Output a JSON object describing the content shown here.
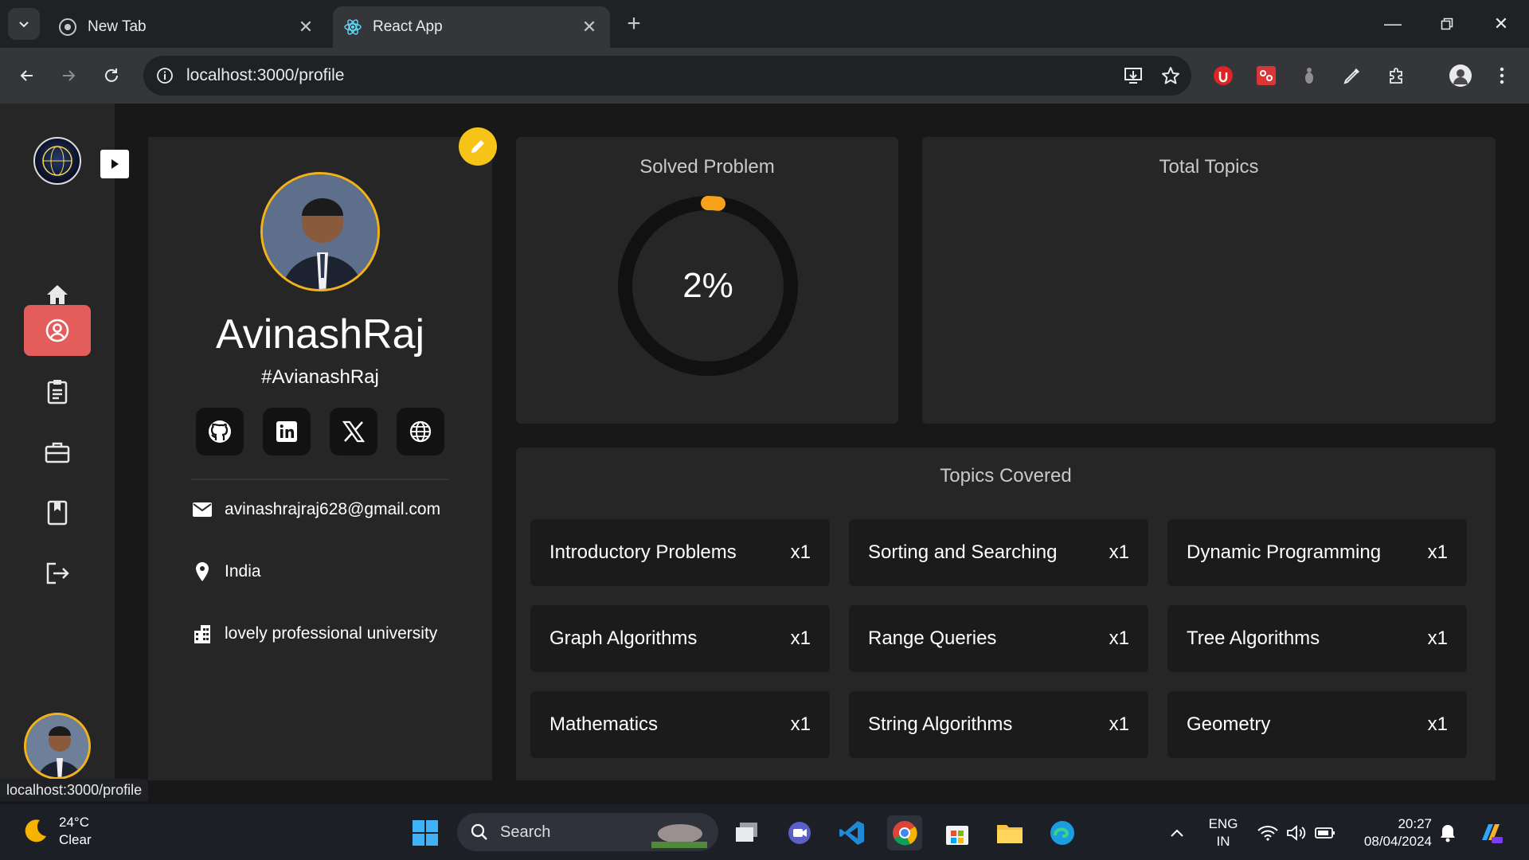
{
  "browser": {
    "tabs": [
      {
        "label": "New Tab",
        "active": false
      },
      {
        "label": "React App",
        "active": true
      }
    ],
    "url": "localhost:3000/profile",
    "status_url": "localhost:3000/profile"
  },
  "profile": {
    "name": "AvinashRaj",
    "handle": "#AvianashRaj",
    "email": "avinashrajraj628@gmail.com",
    "location": "India",
    "organization": "lovely professional university",
    "socials": [
      "github-icon",
      "linkedin-icon",
      "x-icon",
      "globe-icon"
    ]
  },
  "solved": {
    "title": "Solved Problem",
    "percent_label": "2%",
    "percent": 2
  },
  "total_topics": {
    "title": "Total Topics"
  },
  "topics_covered": {
    "title": "Topics Covered",
    "items": [
      {
        "name": "Introductory Problems",
        "count": "x1"
      },
      {
        "name": "Sorting and Searching",
        "count": "x1"
      },
      {
        "name": "Dynamic Programming",
        "count": "x1"
      },
      {
        "name": "Graph Algorithms",
        "count": "x1"
      },
      {
        "name": "Range Queries",
        "count": "x1"
      },
      {
        "name": "Tree Algorithms",
        "count": "x1"
      },
      {
        "name": "Mathematics",
        "count": "x1"
      },
      {
        "name": "String Algorithms",
        "count": "x1"
      },
      {
        "name": "Geometry",
        "count": "x1"
      }
    ]
  },
  "taskbar": {
    "weather_temp": "24°C",
    "weather_desc": "Clear",
    "search_label": "Search",
    "lang_top": "ENG",
    "lang_bottom": "IN",
    "time": "20:27",
    "date": "08/04/2024"
  },
  "colors": {
    "accent_active": "#e35d5d",
    "ring_progress": "#f6a21a",
    "edit_button": "#f6c319"
  }
}
